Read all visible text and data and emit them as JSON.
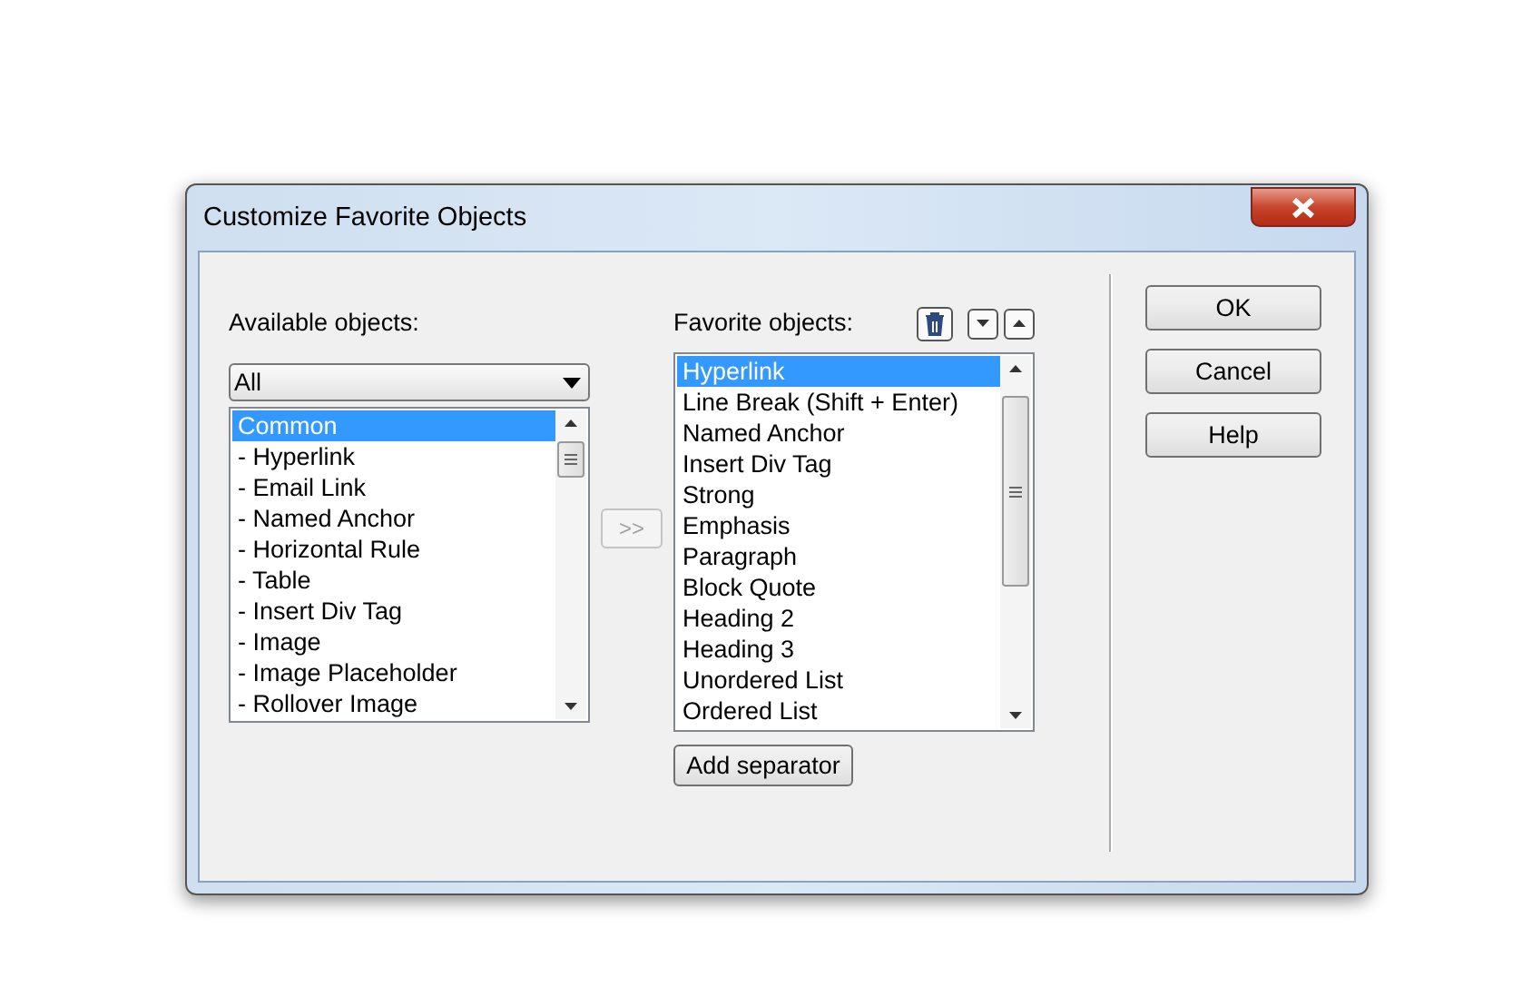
{
  "window": {
    "title": "Customize Favorite Objects"
  },
  "available": {
    "label": "Available objects:",
    "filter": "All",
    "items": [
      {
        "label": "Common",
        "selected": true
      },
      {
        "label": "- Hyperlink",
        "selected": false
      },
      {
        "label": "- Email Link",
        "selected": false
      },
      {
        "label": "- Named Anchor",
        "selected": false
      },
      {
        "label": "- Horizontal Rule",
        "selected": false
      },
      {
        "label": "- Table",
        "selected": false
      },
      {
        "label": "- Insert Div Tag",
        "selected": false
      },
      {
        "label": "- Image",
        "selected": false
      },
      {
        "label": "- Image Placeholder",
        "selected": false
      },
      {
        "label": "- Rollover Image",
        "selected": false
      }
    ]
  },
  "add_button": {
    "label": ">>",
    "disabled": true
  },
  "favorites": {
    "label": "Favorite objects:",
    "items": [
      {
        "label": "Hyperlink",
        "selected": true
      },
      {
        "label": "Line Break (Shift + Enter)",
        "selected": false
      },
      {
        "label": "Named Anchor",
        "selected": false
      },
      {
        "label": "Insert Div Tag",
        "selected": false
      },
      {
        "label": "Strong",
        "selected": false
      },
      {
        "label": "Emphasis",
        "selected": false
      },
      {
        "label": "Paragraph",
        "selected": false
      },
      {
        "label": "Block Quote",
        "selected": false
      },
      {
        "label": "Heading 2",
        "selected": false
      },
      {
        "label": "Heading 3",
        "selected": false
      },
      {
        "label": "Unordered List",
        "selected": false
      },
      {
        "label": "Ordered List",
        "selected": false
      }
    ],
    "add_separator": "Add separator"
  },
  "buttons": [
    "OK",
    "Cancel",
    "Help"
  ]
}
